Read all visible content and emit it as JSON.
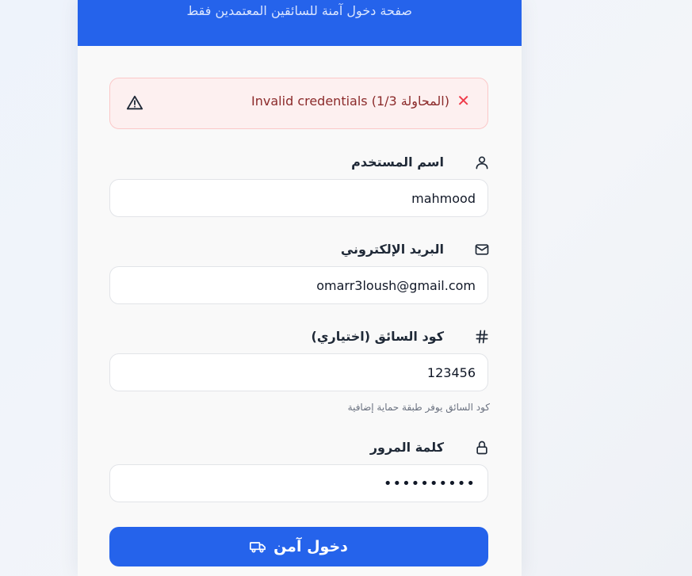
{
  "header": {
    "subtitle": "صفحة دخول آمنة للسائقين المعتمدين فقط"
  },
  "alert": {
    "icon": "x-icon",
    "message": "Invalid credentials (المحاولة 1/3)",
    "warning_icon": "warning-triangle-icon",
    "colors": {
      "background": "#fdf0f0",
      "border": "#fbc8c8",
      "text": "#8b2a2a",
      "x": "#ef3b4a"
    }
  },
  "fields": {
    "username": {
      "label": "اسم المستخدم",
      "value": "mahmood",
      "icon": "user-icon"
    },
    "email": {
      "label": "البريد الإلكتروني",
      "value": "omarr3loush@gmail.com",
      "icon": "mail-icon"
    },
    "driver_code": {
      "label": "كود السائق (اختياري)",
      "value": "123456",
      "hint": "كود السائق يوفر طبقة حماية إضافية",
      "icon": "hash-icon"
    },
    "password": {
      "label": "كلمة المرور",
      "value": "••••••••••",
      "icon": "lock-icon"
    }
  },
  "submit": {
    "label": "دخول آمن",
    "icon": "truck-icon"
  },
  "colors": {
    "primary": "#2563eb",
    "card": "#f9f9f9"
  }
}
